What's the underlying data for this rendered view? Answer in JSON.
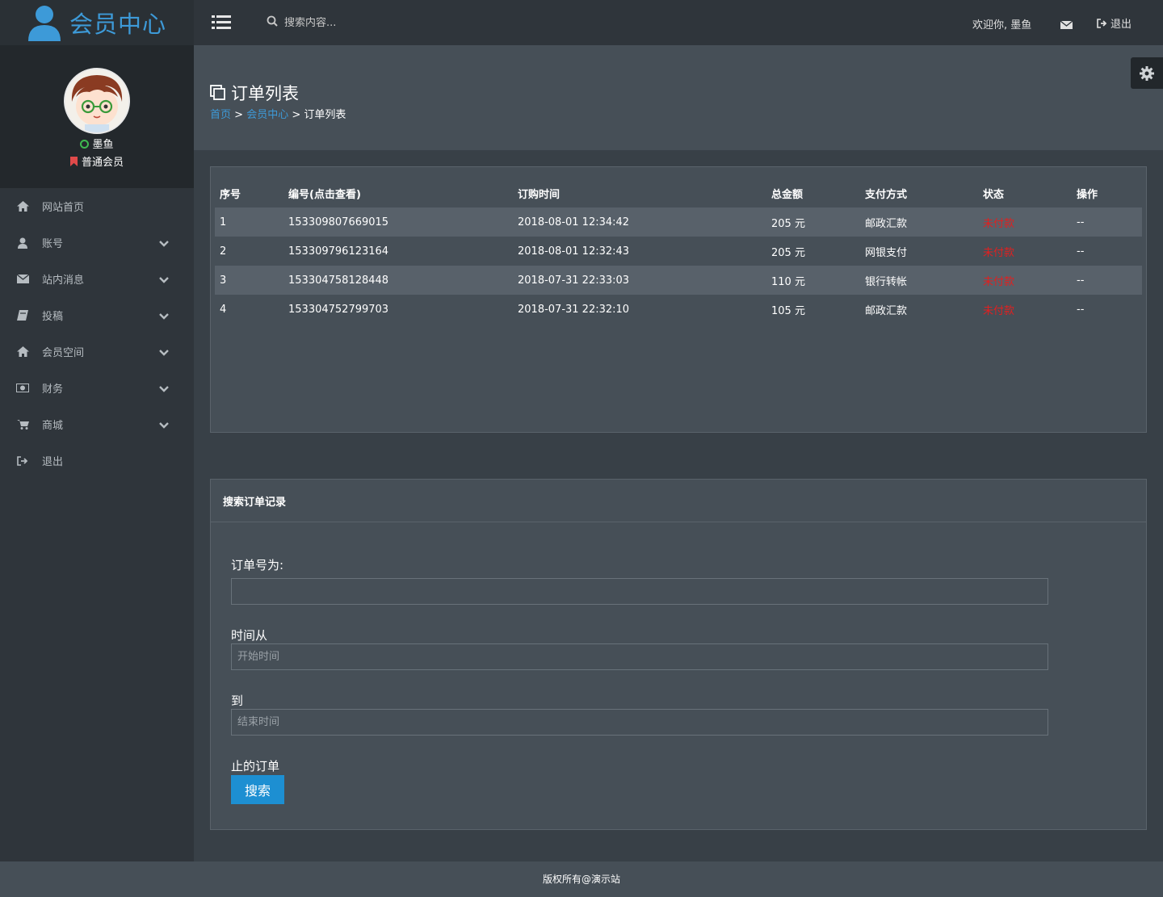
{
  "brand": {
    "title": "会员中心"
  },
  "topbar": {
    "search_placeholder": "搜索内容...",
    "welcome": "欢迎你, 墨鱼",
    "logout": "退出"
  },
  "profile": {
    "name": "墨鱼",
    "level": "普通会员"
  },
  "sidebar": {
    "items": [
      {
        "label": "网站首页",
        "icon": "home-icon"
      },
      {
        "label": "账号",
        "icon": "user-icon"
      },
      {
        "label": "站内消息",
        "icon": "envelope-icon"
      },
      {
        "label": "投稿",
        "icon": "book-icon"
      },
      {
        "label": "会员空间",
        "icon": "home-icon"
      },
      {
        "label": "财务",
        "icon": "money-icon"
      },
      {
        "label": "商城",
        "icon": "cart-icon"
      },
      {
        "label": "退出",
        "icon": "sign-out-icon"
      }
    ]
  },
  "page": {
    "title": "订单列表",
    "breadcrumb": [
      "首页",
      "会员中心",
      "订单列表"
    ],
    "sep": ">"
  },
  "orders": {
    "headers": [
      "序号",
      "编号(点击查看)",
      "订购时间",
      "总金额",
      "支付方式",
      "状态",
      "操作"
    ],
    "rows": [
      [
        "1",
        "153309807669015",
        "2018-08-01 12:34:42",
        "205 元",
        "邮政汇款",
        "未付款",
        "--"
      ],
      [
        "2",
        "153309796123164",
        "2018-08-01 12:32:43",
        "205 元",
        "网银支付",
        "未付款",
        "--"
      ],
      [
        "3",
        "153304758128448",
        "2018-07-31 22:33:03",
        "110 元",
        "银行转帐",
        "未付款",
        "--"
      ],
      [
        "4",
        "153304752799703",
        "2018-07-31 22:32:10",
        "105 元",
        "邮政汇款",
        "未付款",
        "--"
      ]
    ]
  },
  "search": {
    "title": "搜索订单记录",
    "order_label": "订单号为:",
    "from_label": "时间从",
    "from_placeholder": "开始时间",
    "to_label": "到",
    "to_placeholder": "结束时间",
    "suffix_label": "止的订单",
    "button": "搜索"
  },
  "footer": {
    "text": "版权所有@演示站"
  }
}
